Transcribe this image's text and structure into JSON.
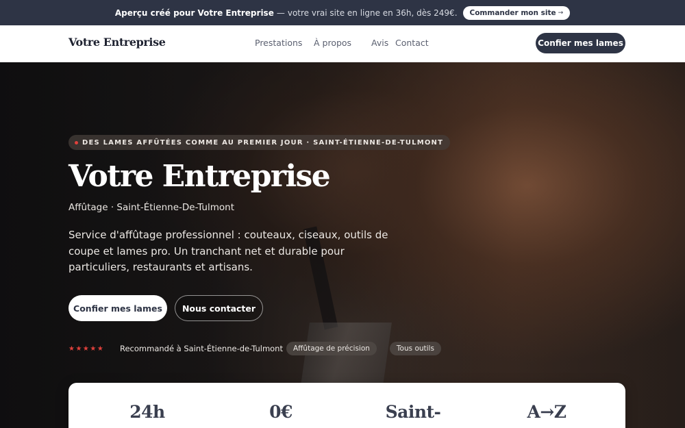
{
  "promo": {
    "bold": "Aperçu créé pour Votre Entreprise",
    "text": "votre vrai site en ligne en 36h, dès 249€.",
    "button": "Commander mon site",
    "button_arrow": "→"
  },
  "nav": {
    "brand": "Votre Entreprise",
    "items": [
      "Prestations",
      "À propos",
      "Avis",
      "Contact"
    ],
    "cta": "Confier mes lames"
  },
  "hero": {
    "eyebrow": "DES LAMES AFFÛTÉES COMME AU PREMIER JOUR · SAINT-ÉTIENNE-DE-TULMONT",
    "title": "Votre Entreprise",
    "subtitle": "Affûtage · Saint-Étienne-De-Tulmont",
    "description": "Service d'affûtage professionnel : couteaux, ciseaux, outils de coupe et lames pro. Un tranchant net et durable pour particuliers, restaurants et artisans.",
    "primary_button": "Confier mes lames",
    "secondary_button": "Nous contacter",
    "stars": "★★★★★",
    "recommendation": "Recommandé à Saint-Étienne-de-Tulmont",
    "chips": [
      "Affûtage de précision",
      "Tous outils"
    ]
  },
  "stats": [
    "24h",
    "0€",
    "Saint-",
    "A→Z"
  ],
  "colors": {
    "accent": "#2e3445",
    "star": "#e0413c"
  }
}
